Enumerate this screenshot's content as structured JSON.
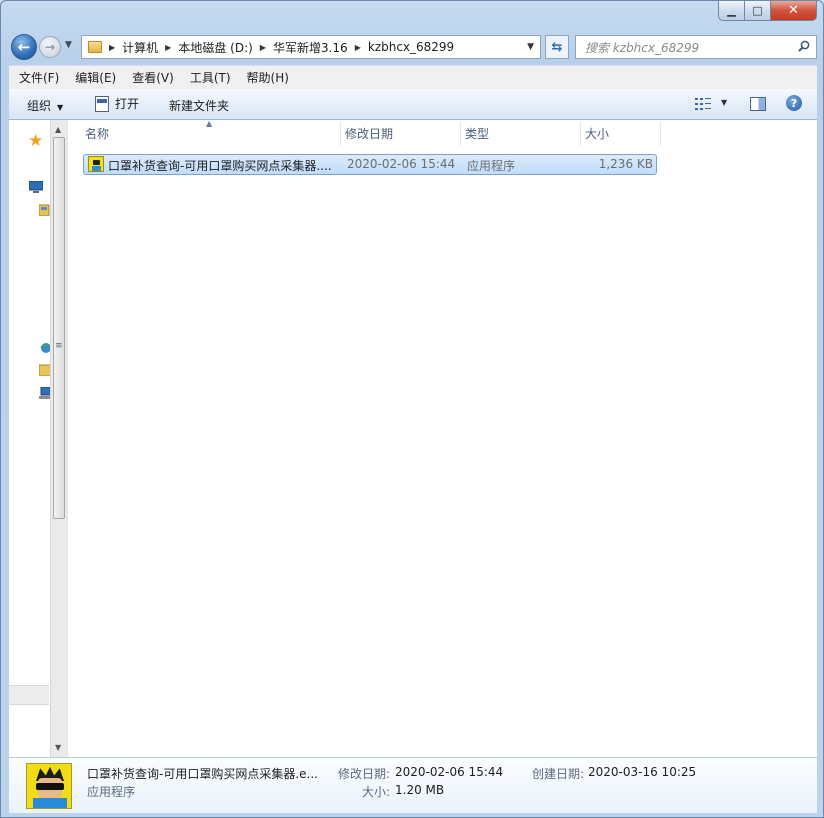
{
  "window": {
    "caption": {
      "minimize_glyph": "▁",
      "maximize_glyph": "□",
      "close_glyph": "✕"
    }
  },
  "nav": {
    "back_glyph": "←",
    "forward_glyph": "→",
    "breadcrumbs": [
      "计算机",
      "本地磁盘 (D:)",
      "华军新增3.16",
      "kzbhcx_68299"
    ],
    "search_placeholder": "搜索 kzbhcx_68299"
  },
  "menubar": {
    "items": [
      "文件(F)",
      "编辑(E)",
      "查看(V)",
      "工具(T)",
      "帮助(H)"
    ]
  },
  "toolbar": {
    "organize_label": "组织",
    "open_label": "打开",
    "new_folder_label": "新建文件夹",
    "help_glyph": "?"
  },
  "columns": {
    "name": "名称",
    "modified": "修改日期",
    "type": "类型",
    "size": "大小"
  },
  "files": [
    {
      "name": "口罩补货查询-可用口罩购买网点采集器....",
      "modified": "2020-02-06 15:44",
      "type": "应用程序",
      "size": "1,236 KB",
      "selected": true
    }
  ],
  "details": {
    "name": "口罩补货查询-可用口罩购买网点采集器.e...",
    "type": "应用程序",
    "modified_label": "修改日期:",
    "modified_value": "2020-02-06 15:44",
    "size_label": "大小:",
    "size_value": "1.20 MB",
    "created_label": "创建日期:",
    "created_value": "2020-03-16 10:25"
  },
  "colors": {
    "selection_bg": "#c1dcfc",
    "selection_border": "#7da2ce",
    "chrome": "#bcd3ec"
  }
}
